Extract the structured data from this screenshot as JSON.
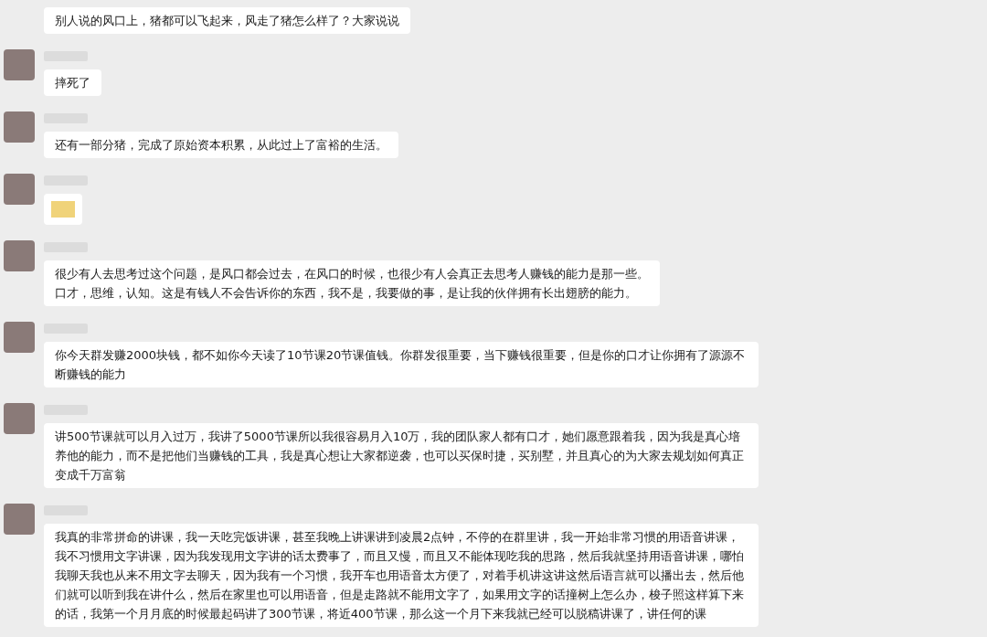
{
  "messages": [
    {
      "kind": "text",
      "show_header": false,
      "text": "别人说的风口上，猪都可以飞起来，风走了猪怎么样了？大家说说"
    },
    {
      "kind": "text",
      "show_header": true,
      "text": "摔死了"
    },
    {
      "kind": "text",
      "show_header": true,
      "text": "还有一部分猪，完成了原始资本积累，从此过上了富裕的生活。"
    },
    {
      "kind": "image",
      "show_header": true
    },
    {
      "kind": "text",
      "show_header": true,
      "text": "很少有人去思考过这个问题，是风口都会过去，在风口的时候，也很少有人会真正去思考人赚钱的能力是那一些。",
      "text_2": "口才，思维，认知。这是有钱人不会告诉你的东西，我不是，我要做的事，是让我的伙伴拥有长出翅膀的能力。"
    },
    {
      "kind": "text",
      "show_header": true,
      "text": "你今天群发赚2000块钱，都不如你今天读了10节课20节课值钱。你群发很重要，当下赚钱很重要，但是你的口才让你拥有了源源不断赚钱的能力"
    },
    {
      "kind": "text",
      "show_header": true,
      "text": "讲500节课就可以月入过万，我讲了5000节课所以我很容易月入10万，我的团队家人都有口才，她们愿意跟着我，因为我是真心培养他的能力，而不是把他们当赚钱的工具，我是真心想让大家都逆袭，也可以买保时捷，买别墅，并且真心的为大家去规划如何真正变成千万富翁"
    },
    {
      "kind": "text",
      "show_header": true,
      "text": "我真的非常拼命的讲课，我一天吃完饭讲课，甚至我晚上讲课讲到凌晨2点钟，不停的在群里讲，我一开始非常习惯的用语音讲课，我不习惯用文字讲课，因为我发现用文字讲的话太费事了，而且又慢，而且又不能体现吃我的思路，然后我就坚持用语音讲课，哪怕我聊天我也从来不用文字去聊天，因为我有一个习惯，我开车也用语音太方便了，对着手机讲这讲这然后语言就可以播出去，然后他们就可以听到我在讲什么，然后在家里也可以用语音，但是走路就不能用文字了，如果用文字的话撞树上怎么办，梭子照这样算下来的话，我第一个月月底的时候最起码讲了300节课，将近400节课，那么这一个月下来我就已经可以脱稿讲课了，讲任何的课"
    }
  ]
}
